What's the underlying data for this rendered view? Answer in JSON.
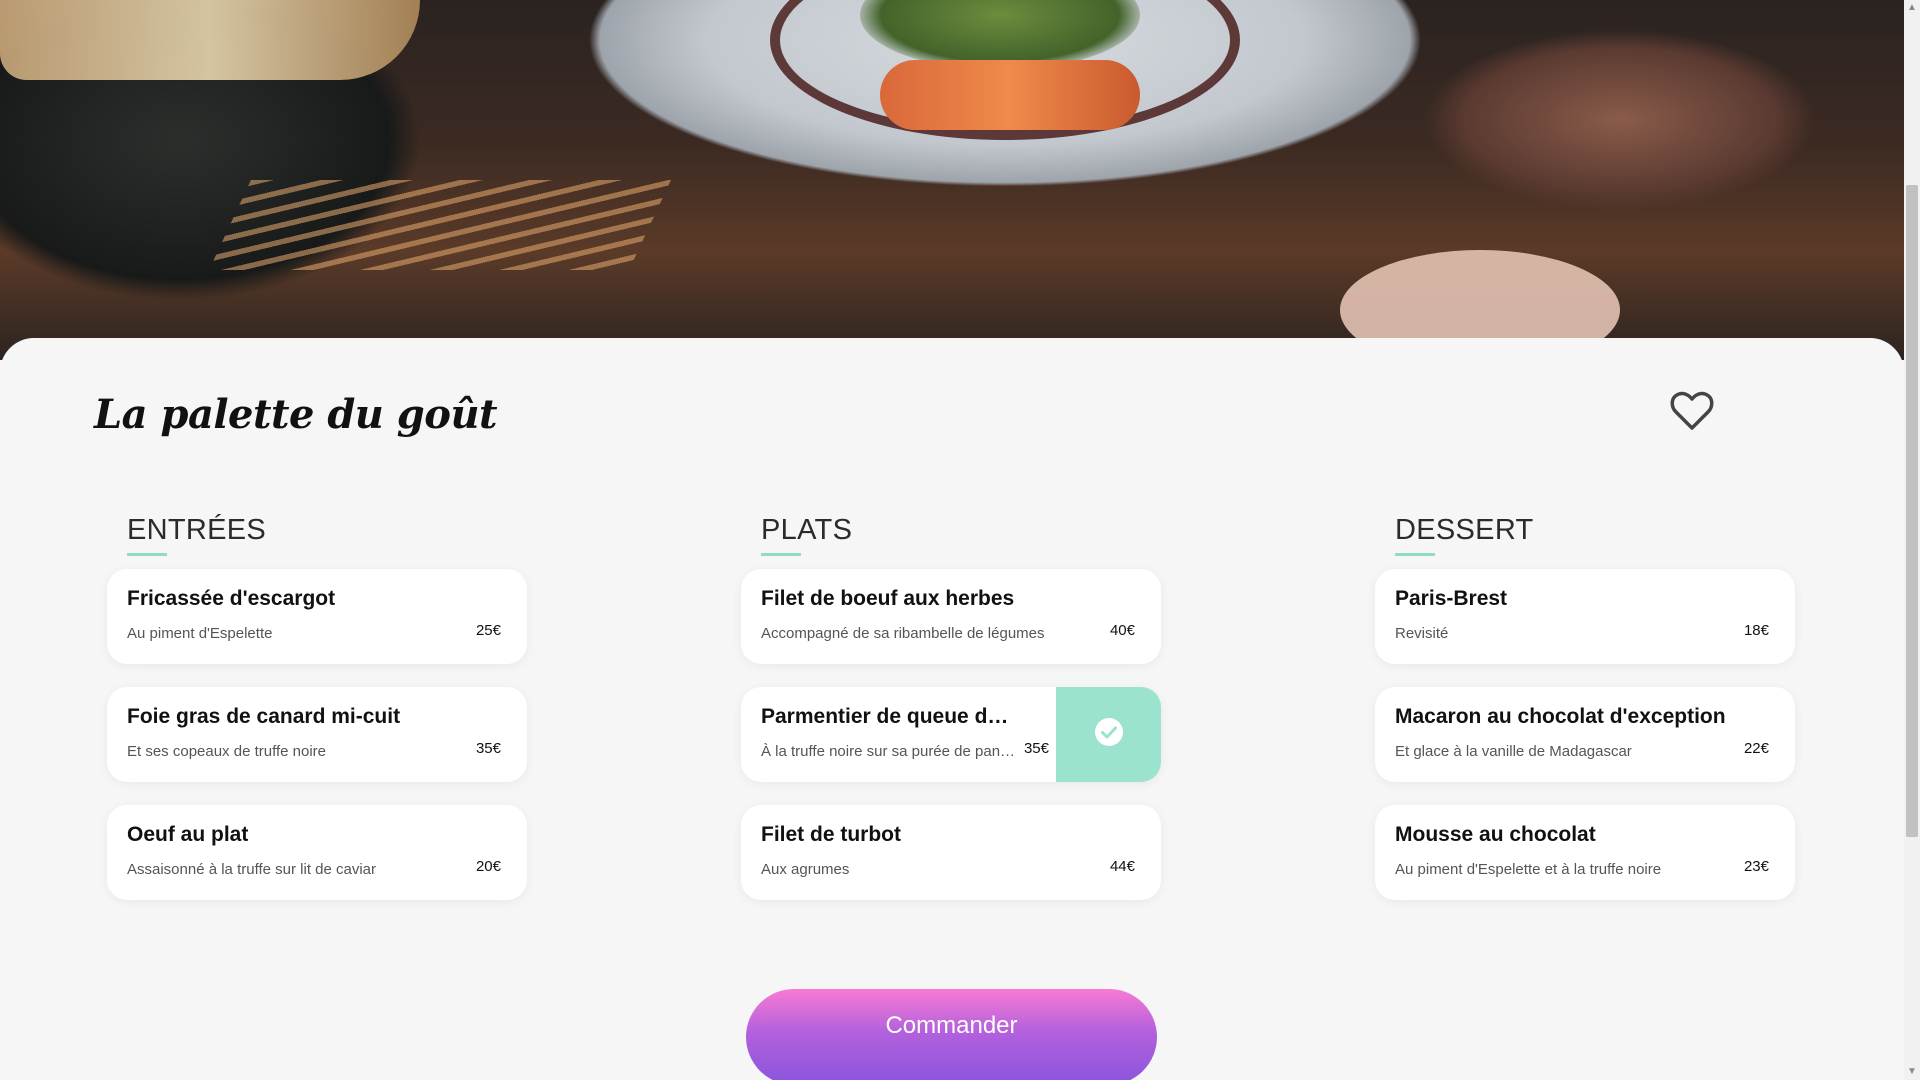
{
  "restaurant": {
    "name": "La palette du goût"
  },
  "icons": {
    "favorite": "heart-outline-icon",
    "selected": "check-circle-icon"
  },
  "colors": {
    "accent_mint": "#9be3cf",
    "underline": "#8fdcc6",
    "button_gradient_top": "#f77bd3",
    "button_gradient_bottom": "#8a55dc"
  },
  "menu": {
    "entrees": {
      "heading": "ENTRÉES",
      "items": [
        {
          "name": "Fricassée d'escargot",
          "description": "Au piment d'Espelette",
          "price": "25€"
        },
        {
          "name": "Foie gras de canard mi-cuit",
          "description": "Et ses copeaux de truffe noire",
          "price": "35€"
        },
        {
          "name": "Oeuf au plat",
          "description": "Assaisonné à la truffe sur lit de caviar",
          "price": "20€"
        }
      ]
    },
    "plats": {
      "heading": "PLATS",
      "items": [
        {
          "name": "Filet de boeuf aux herbes",
          "description": "Accompagné de sa ribambelle de légumes",
          "price": "40€"
        },
        {
          "name": "Parmentier de queue de …",
          "description": "À la truffe noire sur sa purée de pan…",
          "price": "35€",
          "selected": true
        },
        {
          "name": "Filet de turbot",
          "description": "Aux agrumes",
          "price": "44€"
        }
      ]
    },
    "dessert": {
      "heading": "DESSERT",
      "items": [
        {
          "name": "Paris-Brest",
          "description": "Revisité",
          "price": "18€"
        },
        {
          "name": "Macaron au chocolat d'exception",
          "description": "Et glace à la vanille de Madagascar",
          "price": "22€"
        },
        {
          "name": "Mousse au chocolat",
          "description": "Au piment d'Espelette et à la truffe noire",
          "price": "23€"
        }
      ]
    }
  },
  "actions": {
    "order_label": "Commander"
  }
}
